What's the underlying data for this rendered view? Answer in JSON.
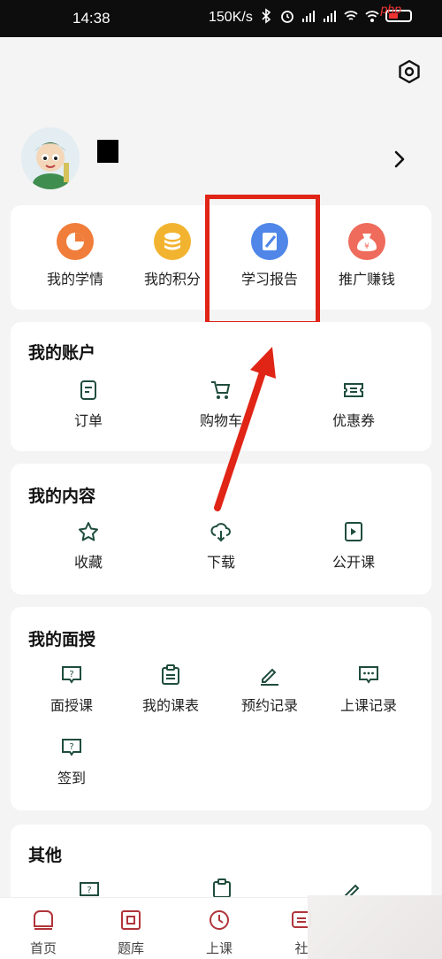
{
  "status_bar": {
    "time": "14:38",
    "network_speed": "150K/s",
    "icons": [
      "bluetooth-icon",
      "alarm-icon",
      "signal-hd-icon",
      "signal-hd-icon",
      "wifi-icon",
      "hotspot-icon",
      "battery-icon"
    ],
    "watermark": "php"
  },
  "quick_actions": [
    {
      "label": "我的学情",
      "icon": "pie-chart-icon",
      "color": "#f07d3a"
    },
    {
      "label": "我的积分",
      "icon": "coins-icon",
      "color": "#f2b430"
    },
    {
      "label": "学习报告",
      "icon": "report-icon",
      "color": "#4f86e8"
    },
    {
      "label": "推广赚钱",
      "icon": "money-bag-icon",
      "color": "#ef6b5b"
    }
  ],
  "account": {
    "title": "我的账户",
    "items": [
      {
        "label": "订单",
        "icon": "order-icon"
      },
      {
        "label": "购物车",
        "icon": "cart-icon"
      },
      {
        "label": "优惠券",
        "icon": "coupon-icon"
      }
    ]
  },
  "content": {
    "title": "我的内容",
    "items": [
      {
        "label": "收藏",
        "icon": "star-icon"
      },
      {
        "label": "下载",
        "icon": "cloud-download-icon"
      },
      {
        "label": "公开课",
        "icon": "video-file-icon"
      }
    ]
  },
  "teaching": {
    "title": "我的面授",
    "items": [
      {
        "label": "面授课",
        "icon": "question-bubble-icon"
      },
      {
        "label": "我的课表",
        "icon": "clipboard-icon"
      },
      {
        "label": "预约记录",
        "icon": "pencil-icon"
      },
      {
        "label": "上课记录",
        "icon": "chat-bubble-icon"
      },
      {
        "label": "签到",
        "icon": "question-bubble-icon"
      }
    ]
  },
  "other": {
    "title": "其他"
  },
  "tab_bar": [
    {
      "label": "首页",
      "icon": "home-icon"
    },
    {
      "label": "题库",
      "icon": "question-bank-icon"
    },
    {
      "label": "上课",
      "icon": "clock-icon"
    },
    {
      "label": "社",
      "icon": "community-icon"
    }
  ],
  "colors": {
    "accent": "#b0343a",
    "highlight": "#e02416",
    "icon_stroke": "#1f4d3c"
  }
}
